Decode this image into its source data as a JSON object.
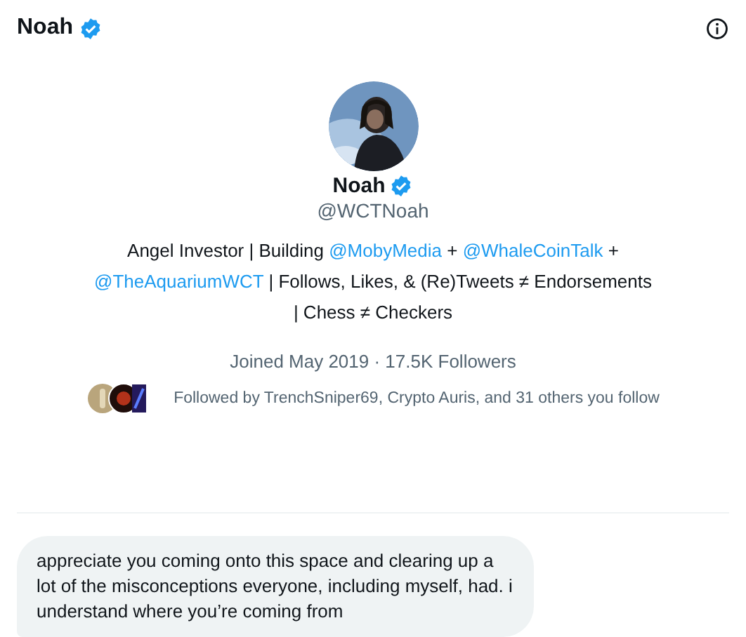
{
  "header": {
    "title": "Noah",
    "verified": true
  },
  "profile": {
    "name": "Noah",
    "verified": true,
    "handle": "@WCTNoah",
    "bio": [
      {
        "kind": "text",
        "text": "Angel Investor | Building "
      },
      {
        "kind": "mention",
        "text": "@MobyMedia"
      },
      {
        "kind": "text",
        "text": " + "
      },
      {
        "kind": "mention",
        "text": "@WhaleCoinTalk"
      },
      {
        "kind": "text",
        "text": " + "
      },
      {
        "kind": "mention",
        "text": "@TheAquariumWCT"
      },
      {
        "kind": "text",
        "text": " | Follows, Likes, & (Re)Tweets ≠ Endorsements | Chess ≠ Checkers"
      }
    ],
    "joined": "Joined May 2019 · 17.5K Followers",
    "followed_by": "Followed by TrenchSniper69, Crypto Auris, and 31 others you follow"
  },
  "messages": [
    {
      "text": "appreciate you coming onto this space and clearing up a lot of the misconceptions everyone, including myself, had. i understand where you’re coming from"
    }
  ]
}
